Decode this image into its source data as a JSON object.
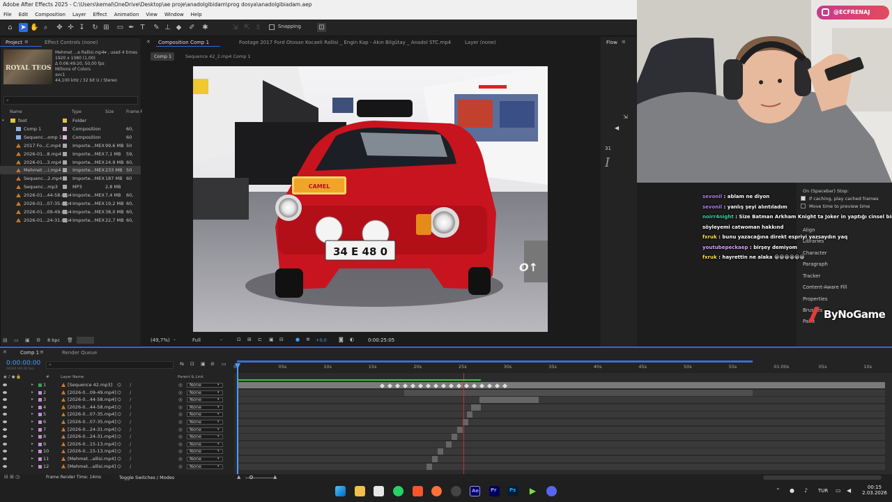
{
  "window": {
    "title": "Adobe After Effects 2025 - C:\\Users\\kemal\\OneDrive\\Desktop\\ae proje\\anadolgibidam\\prog dosya\\anadolgibiadam.aep"
  },
  "menu": [
    "File",
    "Edit",
    "Composition",
    "Layer",
    "Effect",
    "Animation",
    "View",
    "Window",
    "Help"
  ],
  "toolbar": {
    "snapping_label": "Snapping"
  },
  "project_panel": {
    "tabs": [
      "Project",
      "Effect Controls (none)"
    ],
    "info": [
      "Mehmet ...e Rallisi.mp4▾ , used 4 times",
      "1920 x 1080 (1,00)",
      "Δ 0:06:49:20, 50,00 fps",
      "Millions of Colors",
      "avc1",
      "44,100 kHz / 32 bit U / Stereo"
    ],
    "thumb_text": "ROYAL TEOS",
    "columns": [
      "Name",
      "Type",
      "Size",
      "Frame R"
    ],
    "items": [
      {
        "name": "foot",
        "type": "Folder",
        "size": "",
        "fr": "",
        "kind": "folder",
        "label": "#e0c24a"
      },
      {
        "name": "Comp 1",
        "type": "Composition",
        "size": "",
        "fr": "60,",
        "kind": "comp",
        "label": "#d9b8d8"
      },
      {
        "name": "Sequenc...omp 1",
        "type": "Composition",
        "size": "",
        "fr": "60",
        "kind": "comp",
        "label": "#d9b8d8"
      },
      {
        "name": "2017 Fo...C.mp4",
        "type": "Importe...MEX",
        "size": "99,6 MB",
        "fr": "50",
        "kind": "footage",
        "label": "#a9a9a9"
      },
      {
        "name": "2026-01...8.mp4",
        "type": "Importe...MEX",
        "size": "7,1 MB",
        "fr": "59,",
        "kind": "footage",
        "label": "#a9a9a9"
      },
      {
        "name": "2026-01...3.mp4",
        "type": "Importe...MEX",
        "size": "24,9 MB",
        "fr": "60,",
        "kind": "footage",
        "label": "#a9a9a9"
      },
      {
        "name": "Mehmet ...i.mp4",
        "type": "Importe...MEX",
        "size": "233 MB",
        "fr": "50",
        "kind": "footage",
        "label": "#a9a9a9",
        "selected": true
      },
      {
        "name": "Sequenc...2.mp4",
        "type": "Importe...MEX",
        "size": "187 MB",
        "fr": "60",
        "kind": "footage",
        "label": "#a9a9a9"
      },
      {
        "name": "Sequenc...mp3",
        "type": "MP3",
        "size": "2,8 MB",
        "fr": "",
        "kind": "footage",
        "label": "#a9a9a9"
      },
      {
        "name": "2026-01...44-58.mp4",
        "type": "Importe...MEX",
        "size": "7,4 MB",
        "fr": "60,",
        "kind": "footage",
        "label": "#a9a9a9"
      },
      {
        "name": "2026-01...07-35.mp4",
        "type": "Importe...MEX",
        "size": "19,2 MB",
        "fr": "60,",
        "kind": "footage",
        "label": "#a9a9a9"
      },
      {
        "name": "2026-01...09-49.mp4",
        "type": "Importe...MEX",
        "size": "38,0 MB",
        "fr": "60,",
        "kind": "footage",
        "label": "#a9a9a9"
      },
      {
        "name": "2026-01...24-31.mp4",
        "type": "Importe...MEX",
        "size": "22,7 MB",
        "fr": "60,",
        "kind": "footage",
        "label": "#a9a9a9"
      }
    ],
    "bpc": "8 bpc"
  },
  "composition_panel": {
    "tabs": [
      "Composition Comp 1",
      "Footage 2017 Ford Otosan Kocaeli Rallisi _ Engin Kap - Akın Bilgütay _ Anadol STC.mp4",
      "Layer (none)"
    ],
    "subtabs": [
      "Comp 1",
      "Sequence 42_2.mp4 Comp 1"
    ],
    "zoom": "(49,7%)",
    "resolution": "Full",
    "exposure": "+0,0",
    "timecode": "0:00:25:05",
    "plate": "34 E 48 0"
  },
  "flow_panel": {
    "title": "Flow",
    "number": "31"
  },
  "stream": {
    "instagram": "@ECFRENAJ",
    "watermark": "ByNoGame",
    "chat": [
      {
        "user": "sevonil",
        "color": "#b07cff",
        "text": "ablam ne diyon"
      },
      {
        "user": "sevonil",
        "color": "#b07cff",
        "text": "yanlış şeyi alıntıladım"
      },
      {
        "user": "noirr4night",
        "color": "#3fd1a6",
        "text": "Size Batman Arkham Knight ta Joker in yaptığı cinsel bir e"
      },
      {
        "user": "",
        "color": "#ffffff",
        "text": "söyleyemi catwoman hakkınd"
      },
      {
        "user": "fxruk",
        "color": "#ffe14a",
        "text": "bunu yazacağına direkt espriyi yazsaydın yaq"
      },
      {
        "user": "youtubepeckaep",
        "color": "#d9a2ff",
        "text": "birşey demiyom"
      },
      {
        "user": "fxruk",
        "color": "#ffe14a",
        "text": "hayrettin ne alaka 😀😀😀😀😀😀"
      }
    ]
  },
  "right_panels": {
    "preview_label": "On (Spacebar) Stop:",
    "opt1": "If caching, play cached frames",
    "opt2": "Move time to preview time",
    "items": [
      "Align",
      "Libraries",
      "Character",
      "Paragraph",
      "Tracker",
      "Content-Aware Fill",
      "Properties",
      "Brushes",
      "Paint"
    ]
  },
  "timeline": {
    "tabs": [
      "Comp 1",
      "Render Queue"
    ],
    "timecode": "0:00:00:00",
    "timecode_sub": "00000 (60.00 fps)",
    "headers": {
      "num": "#",
      "name": "Layer Name",
      "parent": "Parent & Link"
    },
    "layers": [
      {
        "n": "1",
        "name": "[Sequence 42.mp3]",
        "parent": "None"
      },
      {
        "n": "2",
        "name": "[2026-0...09-49.mp4]",
        "parent": "None"
      },
      {
        "n": "3",
        "name": "[2026-0...44-58.mp4]",
        "parent": "None"
      },
      {
        "n": "4",
        "name": "[2026-0...44-58.mp4]",
        "parent": "None"
      },
      {
        "n": "5",
        "name": "[2026-0...07-35.mp4]",
        "parent": "None"
      },
      {
        "n": "6",
        "name": "[2026-0...07-35.mp4]",
        "parent": "None"
      },
      {
        "n": "7",
        "name": "[2026-0...24-31.mp4]",
        "parent": "None"
      },
      {
        "n": "8",
        "name": "[2026-0...24-31.mp4]",
        "parent": "None"
      },
      {
        "n": "9",
        "name": "[2026-0...15-13.mp4]",
        "parent": "None"
      },
      {
        "n": "10",
        "name": "[2026-0...15-13.mp4]",
        "parent": "None"
      },
      {
        "n": "11",
        "name": "[Mehmet...allisi.mp4]",
        "parent": "None"
      },
      {
        "n": "12",
        "name": "[Mehmet...allisi.mp4]",
        "parent": "None"
      }
    ],
    "ruler": [
      "0s",
      "05s",
      "10s",
      "15s",
      "20s",
      "25s",
      "30s",
      "35s",
      "40s",
      "45s",
      "50s",
      "55s",
      "01:00s",
      "05s",
      "10s"
    ],
    "footer": {
      "render_time": "Frame Render Time: 14ms",
      "toggle": "Toggle Switches / Modes"
    }
  },
  "taskbar": {
    "lang": "TUR",
    "time": "00:15",
    "date": "2.03.2026"
  }
}
